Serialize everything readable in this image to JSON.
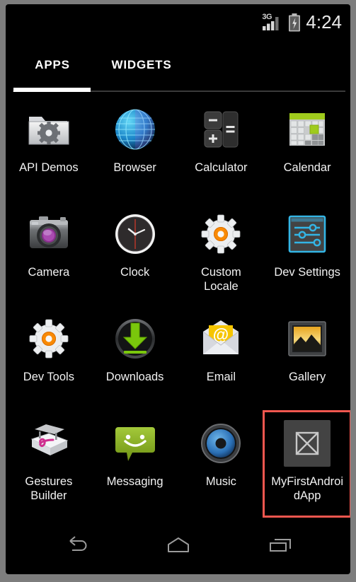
{
  "status_bar": {
    "network_label": "3G",
    "signal_icon": "signal-bars-icon",
    "battery_icon": "battery-charging-icon",
    "time": "4:24"
  },
  "tabs": [
    {
      "label": "APPS",
      "selected": true,
      "name": "tab-apps"
    },
    {
      "label": "WIDGETS",
      "selected": false,
      "name": "tab-widgets"
    }
  ],
  "apps": [
    {
      "label": "API Demos",
      "icon": "folder-gear-icon",
      "highlighted": false
    },
    {
      "label": "Browser",
      "icon": "globe-icon",
      "highlighted": false
    },
    {
      "label": "Calculator",
      "icon": "calculator-keys-icon",
      "highlighted": false
    },
    {
      "label": "Calendar",
      "icon": "calendar-grid-icon",
      "highlighted": false
    },
    {
      "label": "Camera",
      "icon": "camera-icon",
      "highlighted": false
    },
    {
      "label": "Clock",
      "icon": "analog-clock-icon",
      "highlighted": false
    },
    {
      "label": "Custom Locale",
      "icon": "gear-orange-icon",
      "highlighted": false
    },
    {
      "label": "Dev Settings",
      "icon": "sliders-icon",
      "highlighted": false
    },
    {
      "label": "Dev Tools",
      "icon": "gear-orange-icon",
      "highlighted": false
    },
    {
      "label": "Downloads",
      "icon": "download-arrow-icon",
      "highlighted": false
    },
    {
      "label": "Email",
      "icon": "envelope-at-icon",
      "highlighted": false
    },
    {
      "label": "Gallery",
      "icon": "photo-frame-icon",
      "highlighted": false
    },
    {
      "label": "Gestures Builder",
      "icon": "gesture-notepad-icon",
      "highlighted": false
    },
    {
      "label": "Messaging",
      "icon": "speech-bubble-smile-icon",
      "highlighted": false
    },
    {
      "label": "Music",
      "icon": "speaker-icon",
      "highlighted": false
    },
    {
      "label": "MyFirstAndroidApp",
      "icon": "placeholder-x-icon",
      "highlighted": true
    }
  ],
  "nav_bar": [
    {
      "name": "nav-back-button",
      "icon": "back-arrow-icon"
    },
    {
      "name": "nav-home-button",
      "icon": "home-icon"
    },
    {
      "name": "nav-recents-button",
      "icon": "recents-icon"
    }
  ],
  "colors": {
    "screen_background": "#000000",
    "bezel": "#7d7d7d",
    "highlight_border": "#f2574f",
    "tab_selected_underline": "#ffffff",
    "accent_green": "#a4c639",
    "accent_blue": "#33b5e5",
    "accent_orange": "#ff8800",
    "label_text": "#f2f2f2"
  }
}
